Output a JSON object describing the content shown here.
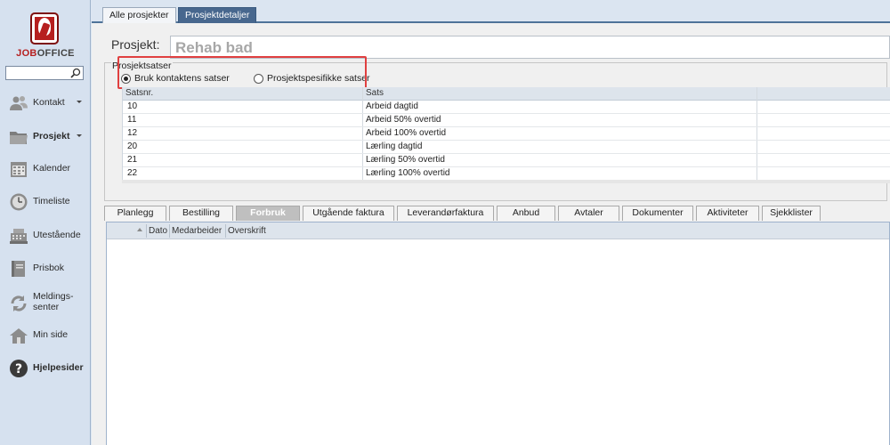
{
  "app": {
    "logo_text_a": "JOB",
    "logo_text_b": "OFFICE",
    "brand_color": "#b61f1f"
  },
  "sidebar": {
    "search_placeholder": "",
    "items": [
      {
        "label": "Kontakt",
        "icon": "people-icon",
        "has_caret": true
      },
      {
        "label": "Prosjekt",
        "icon": "folder-icon",
        "has_caret": true,
        "active": true
      },
      {
        "label": "Kalender",
        "icon": "calendar-icon"
      },
      {
        "label": "Timeliste",
        "icon": "clock-icon"
      },
      {
        "label": "Utestående",
        "icon": "cash-register-icon"
      },
      {
        "label": "Prisbok",
        "icon": "book-icon"
      },
      {
        "label": "Meldings-senter",
        "label_line1": "Meldings-",
        "label_line2": "senter",
        "icon": "refresh-icon"
      },
      {
        "label": "Min side",
        "icon": "house-icon"
      },
      {
        "label": "Hjelpesider",
        "icon": "help-icon",
        "bold": true
      }
    ]
  },
  "top_tabs": [
    {
      "label": "Alle prosjekter",
      "active": false
    },
    {
      "label": "Prosjektdetaljer",
      "active": true
    }
  ],
  "project": {
    "label": "Prosjekt:",
    "name": "Rehab bad"
  },
  "rates": {
    "group_label": "Prosjektsatser",
    "options": [
      {
        "label": "Bruk kontaktens satser",
        "selected": true
      },
      {
        "label": "Prosjektspesifikke satser",
        "selected": false
      }
    ],
    "columns": [
      "Satsnr.",
      "Sats"
    ],
    "rows": [
      {
        "nr": "10",
        "sats": "Arbeid dagtid"
      },
      {
        "nr": "11",
        "sats": "Arbeid 50% overtid"
      },
      {
        "nr": "12",
        "sats": "Arbeid 100% overtid"
      },
      {
        "nr": "20",
        "sats": "Lærling dagtid"
      },
      {
        "nr": "21",
        "sats": "Lærling 50% overtid"
      },
      {
        "nr": "22",
        "sats": "Lærling 100% overtid"
      }
    ]
  },
  "lower_tabs": [
    {
      "label": "Planlegg",
      "active": false
    },
    {
      "label": "Bestilling",
      "active": false
    },
    {
      "label": "Forbruk",
      "active": true
    },
    {
      "label": "Utgående faktura",
      "active": false
    },
    {
      "label": "Leverandørfaktura",
      "active": false
    },
    {
      "label": "Anbud",
      "active": false
    },
    {
      "label": "Avtaler",
      "active": false
    },
    {
      "label": "Dokumenter",
      "active": false
    },
    {
      "label": "Aktiviteter",
      "active": false
    },
    {
      "label": "Sjekklister",
      "active": false
    }
  ],
  "consumption_grid": {
    "columns": [
      "Dato",
      "Medarbeider",
      "Overskrift"
    ]
  },
  "colors": {
    "active_tab": "#47678e",
    "highlight_box": "#e04040",
    "sidebar_bg": "#d6e1ef"
  }
}
